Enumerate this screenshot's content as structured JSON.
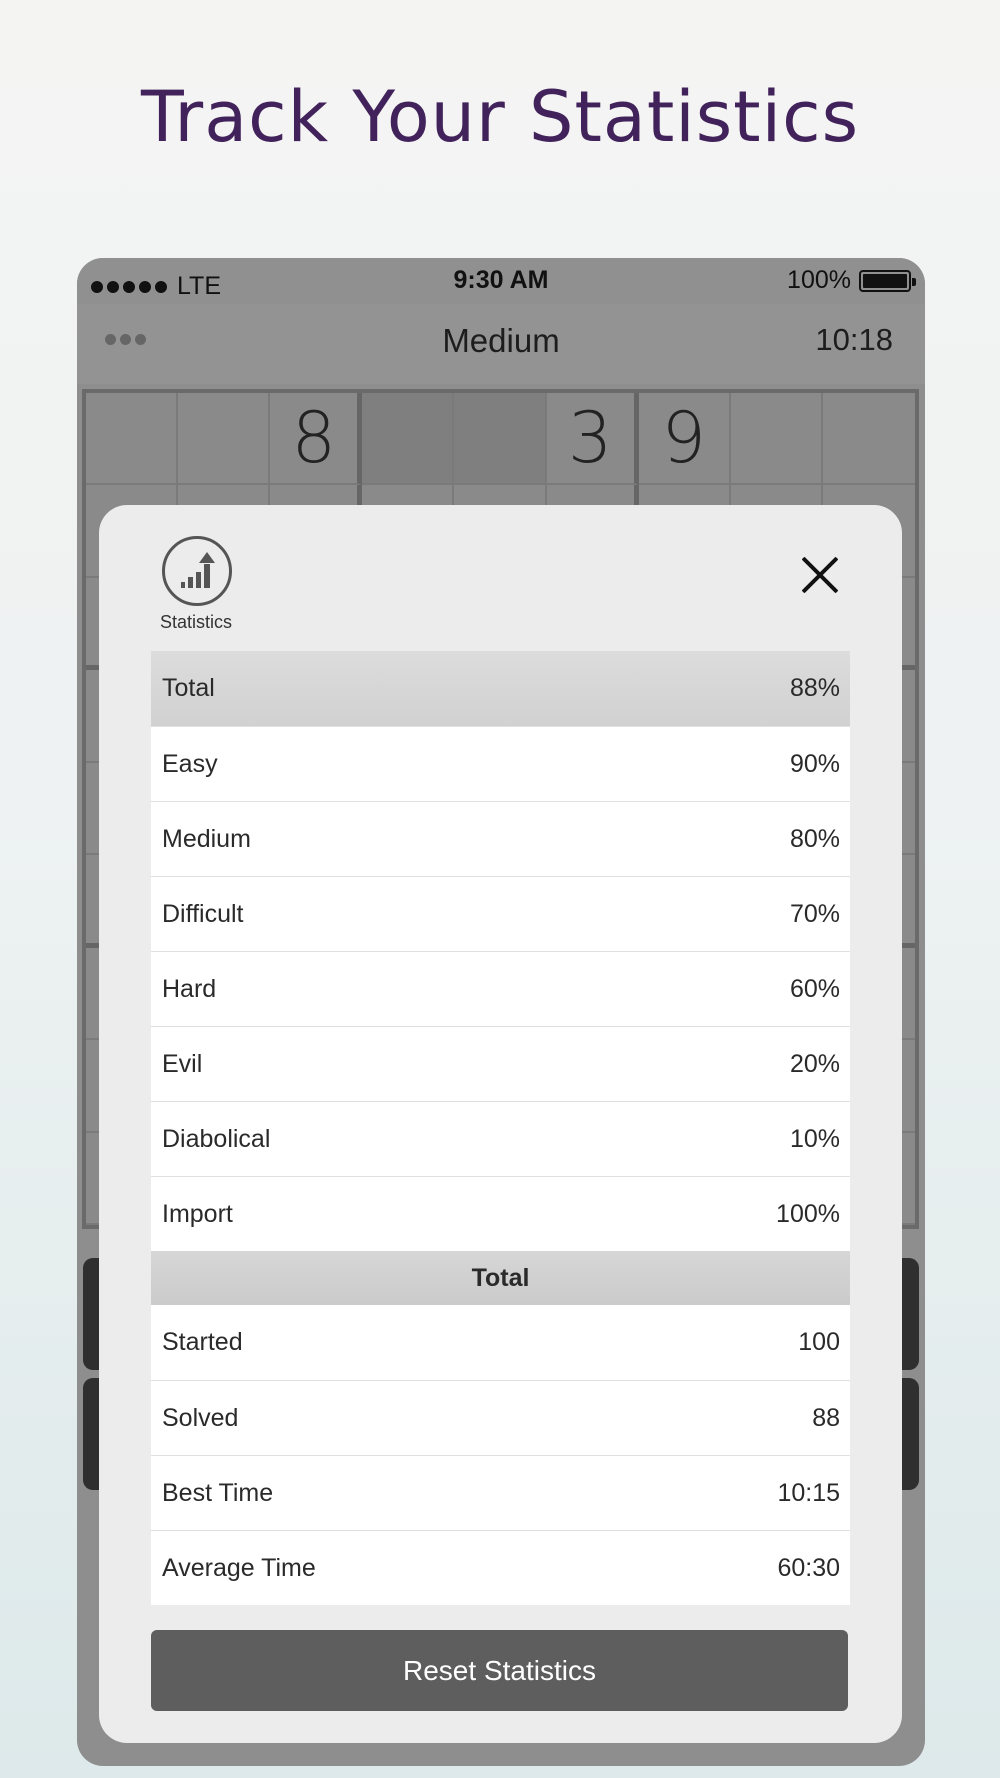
{
  "headline": "Track Your Statistics",
  "status_bar": {
    "carrier": "LTE",
    "time": "9:30 AM",
    "battery": "100%",
    "signal_bars": 5
  },
  "nav": {
    "title": "Medium",
    "timer": "10:18",
    "menu_icon": "more-dots-icon"
  },
  "board": {
    "visible_digits": [
      {
        "row": 0,
        "col": 2,
        "digit": "8"
      },
      {
        "row": 0,
        "col": 5,
        "digit": "3"
      },
      {
        "row": 0,
        "col": 6,
        "digit": "9"
      }
    ]
  },
  "modal": {
    "icon": "statistics-chart-icon",
    "icon_label": "Statistics",
    "close_icon": "close-icon",
    "header_row": {
      "label": "Total",
      "value": "88%"
    },
    "difficulty_rows": [
      {
        "label": "Easy",
        "value": "90%"
      },
      {
        "label": "Medium",
        "value": "80%"
      },
      {
        "label": "Difficult",
        "value": "70%"
      },
      {
        "label": "Hard",
        "value": "60%"
      },
      {
        "label": "Evil",
        "value": "20%"
      },
      {
        "label": "Diabolical",
        "value": "10%"
      },
      {
        "label": "Import",
        "value": "100%"
      }
    ],
    "section_title": "Total",
    "total_rows": [
      {
        "label": "Started",
        "value": "100"
      },
      {
        "label": "Solved",
        "value": "88"
      },
      {
        "label": "Best Time",
        "value": "10:15"
      },
      {
        "label": "Average Time",
        "value": "60:30"
      }
    ],
    "reset_label": "Reset Statistics"
  },
  "colors": {
    "headline": "#42225a",
    "reset_button": "#5e5e5e"
  }
}
